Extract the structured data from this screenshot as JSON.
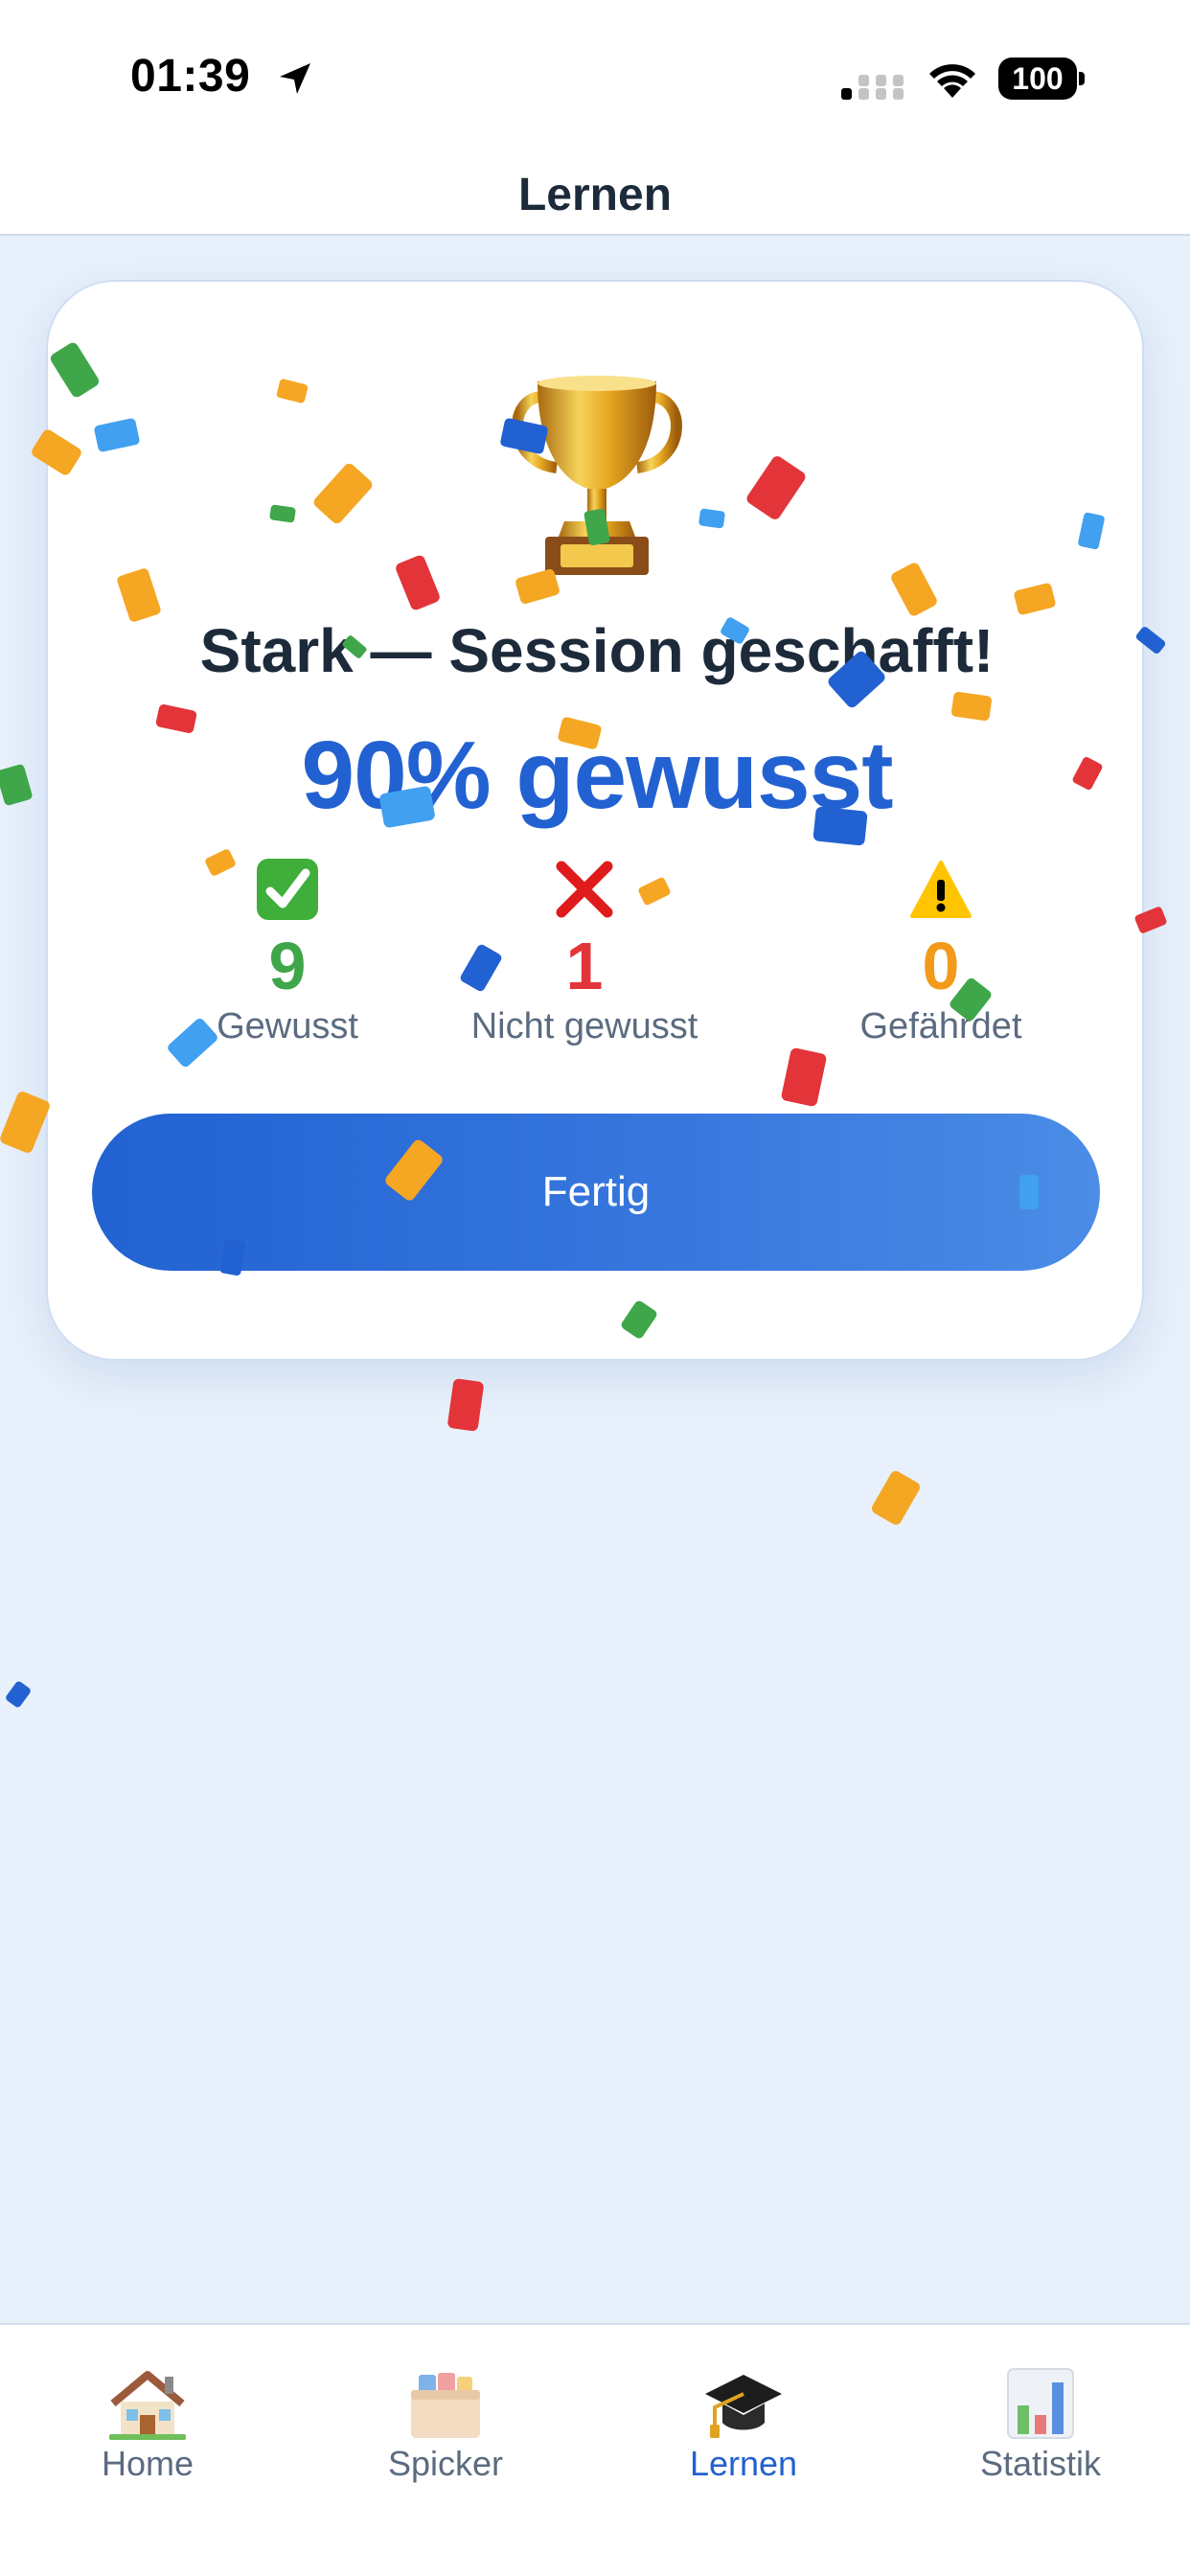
{
  "status_bar": {
    "time": "01:39",
    "battery": "100",
    "icons": [
      "location-arrow-icon",
      "cellular-signal-icon",
      "wifi-icon",
      "battery-icon"
    ]
  },
  "nav": {
    "title": "Lernen"
  },
  "result": {
    "headline": "Stark — Session geschafft!",
    "score": "90% gewusst",
    "trophy_icon": "trophy-icon",
    "stats": [
      {
        "icon": "check-mark-icon",
        "value": "9",
        "label": "Gewusst",
        "color": "#3fa64a"
      },
      {
        "icon": "cross-mark-icon",
        "value": "1",
        "label": "Nicht gewusst",
        "color": "#e3343a"
      },
      {
        "icon": "warning-icon",
        "value": "0",
        "label": "Gefährdet",
        "color": "#f39a1a"
      }
    ],
    "done_button": "Fertig"
  },
  "tabs": [
    {
      "label": "Home",
      "icon": "house-icon",
      "active": false
    },
    {
      "label": "Spicker",
      "icon": "card-box-icon",
      "active": false
    },
    {
      "label": "Lernen",
      "icon": "graduation-cap-icon",
      "active": true
    },
    {
      "label": "Statistik",
      "icon": "bar-chart-icon",
      "active": false
    }
  ],
  "colors": {
    "accent": "#2261d1",
    "background": "#e7f0fb",
    "confetti": [
      "#3fa64a",
      "#f5a623",
      "#2261d1",
      "#e3343a",
      "#41a0f0"
    ]
  }
}
